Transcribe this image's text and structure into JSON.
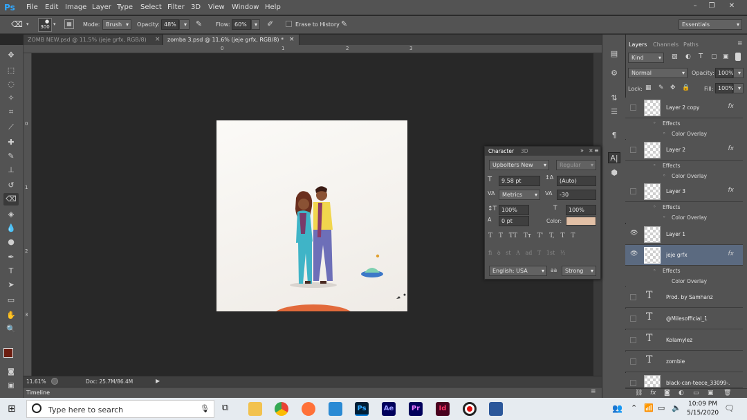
{
  "app": {
    "logo": "Ps",
    "menu": [
      "File",
      "Edit",
      "Image",
      "Layer",
      "Type",
      "Select",
      "Filter",
      "3D",
      "View",
      "Window",
      "Help"
    ],
    "window_controls": [
      "–",
      "❐",
      "✕"
    ]
  },
  "options": {
    "brush_size": "300",
    "mode_label": "Mode:",
    "mode_value": "Brush",
    "opacity_label": "Opacity:",
    "opacity_value": "48%",
    "flow_label": "Flow:",
    "flow_value": "60%",
    "erase_history": "Erase to History",
    "workspace": "Essentials"
  },
  "tabs": [
    {
      "label": "ZOMB NEW.psd @ 11.5% (jeje grfx, RGB/8)",
      "close": "×"
    },
    {
      "label": "zomba 3.psd @ 11.6% (jeje grfx, RGB/8) *",
      "close": "×"
    }
  ],
  "ruler": {
    "top": [
      "0",
      "1",
      "2",
      "3"
    ],
    "left": [
      "0",
      "1",
      "2",
      "3"
    ]
  },
  "status": {
    "zoom": "11.61%",
    "doc": "Doc: 25.7M/86.4M"
  },
  "timeline": {
    "label": "Timeline"
  },
  "character": {
    "tabs": [
      "Character",
      "3D"
    ],
    "font_family": "Upbolters New",
    "font_style": "Regular",
    "size": "9.58 pt",
    "leading": "(Auto)",
    "kerning": "Metrics",
    "tracking": "-30",
    "vscale": "100%",
    "hscale": "100%",
    "baseline": "0 pt",
    "color_label": "Color:",
    "color": "#e2c0a6",
    "styles_row1": [
      "T",
      "T",
      "TT",
      "Tт",
      "T'",
      "T,",
      "T",
      "T"
    ],
    "styles_row2": [
      "fi",
      "ꝺ",
      "st",
      "A",
      "ad",
      "T",
      "1st",
      "½"
    ],
    "language": "English: USA",
    "aa_label": "aa",
    "antialias": "Strong"
  },
  "layers_panel": {
    "tabs": [
      "Layers",
      "Channels",
      "Paths"
    ],
    "kind": "Kind",
    "blend": "Normal",
    "opacity_label": "Opacity:",
    "opacity": "100%",
    "lock_label": "Lock:",
    "fill_label": "Fill:",
    "fill": "100%",
    "effects_label": "Effects",
    "color_overlay": "Color Overlay",
    "layers": [
      "Layer 2 copy",
      "Layer 2",
      "Layer 3",
      "Layer 1",
      "jeje grfx",
      "Prod. by  Samhanz",
      "@Milesofficial_1",
      "Kolamylez",
      "zombie",
      "black-can-teece_33099-..."
    ]
  },
  "taskbar": {
    "search_placeholder": "Type here to search",
    "time": "10:09 PM",
    "date": "5/15/2020",
    "app_labels": {
      "ps": "Ps",
      "ae": "Ae",
      "pr": "Pr",
      "id": "Id"
    }
  }
}
